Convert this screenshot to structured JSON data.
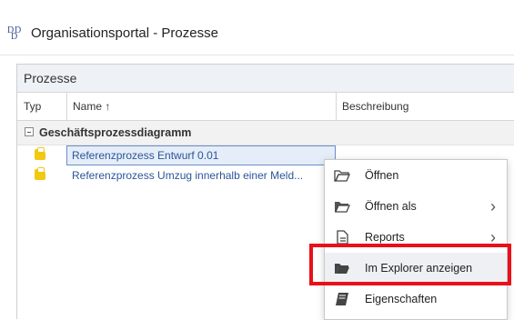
{
  "window": {
    "title": "Organisationsportal - Prozesse",
    "logo_icon": "organisation-portal-logo-icon"
  },
  "panel": {
    "title": "Prozesse",
    "columns": {
      "typ": "Typ",
      "name": "Name ↑",
      "beschreibung": "Beschreibung"
    },
    "group": {
      "label": "Geschäftsprozessdiagramm",
      "toggle_icon": "collapse-minus-icon"
    },
    "rows": [
      {
        "name": "Referenzprozess Entwurf 0.01",
        "selected": true,
        "icon": "process-diagram-icon"
      },
      {
        "name": "Referenzprozess Umzug innerhalb einer Meld...",
        "selected": false,
        "icon": "process-diagram-icon"
      }
    ]
  },
  "context_menu": {
    "items": [
      {
        "label": "Öffnen",
        "icon": "folder-open-outline-icon",
        "submenu": false
      },
      {
        "label": "Öffnen als",
        "icon": "folder-open-icon",
        "submenu": true
      },
      {
        "label": "Reports",
        "icon": "report-document-icon",
        "submenu": true
      },
      {
        "label": "Im Explorer anzeigen",
        "icon": "folder-filled-icon",
        "submenu": false,
        "highlighted": true
      },
      {
        "label": "Eigenschaften",
        "icon": "properties-book-icon",
        "submenu": false
      }
    ]
  },
  "colors": {
    "accent_link": "#2a5599",
    "highlight_box": "#e8101a",
    "process_icon": "#f2c811"
  }
}
